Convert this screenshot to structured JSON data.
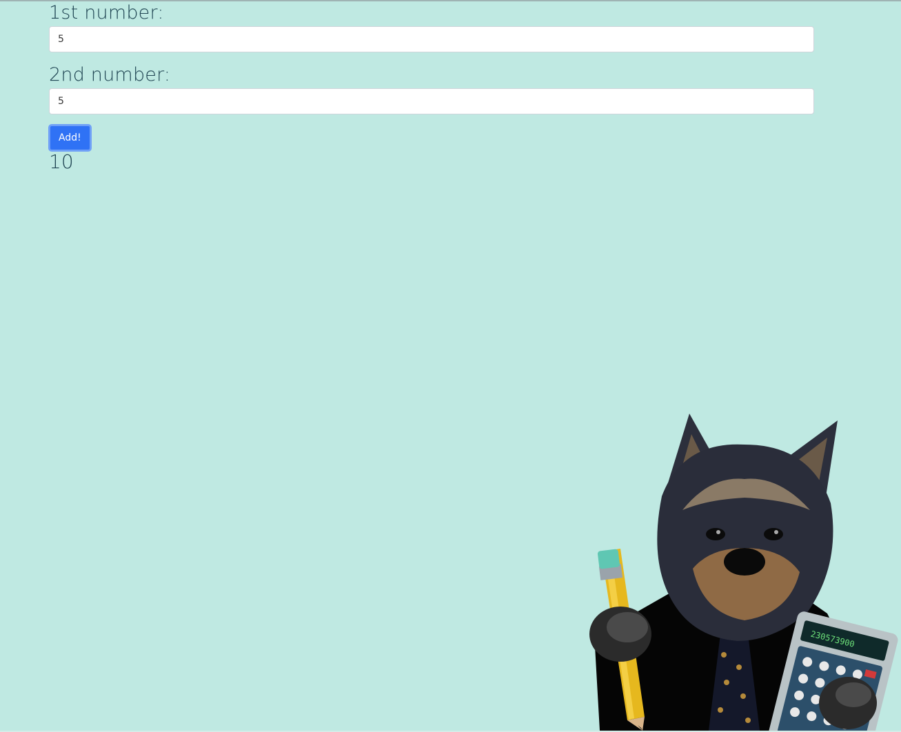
{
  "form": {
    "first_label": "1st number:",
    "first_value": "5",
    "second_label": "2nd number:",
    "second_value": "5",
    "add_button_label": "Add!",
    "result": "10"
  },
  "mascot": {
    "calculator_display": "230573900"
  },
  "colors": {
    "background": "#bfe9e2",
    "text": "#1f4452",
    "button": "#2f72f5",
    "button_focus_ring": "#6fa0f7"
  },
  "icons": {
    "mascot": "dog-with-pencil-and-calculator-illustration"
  }
}
